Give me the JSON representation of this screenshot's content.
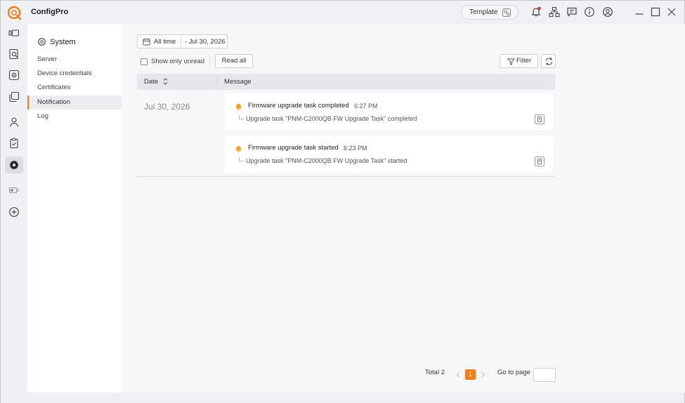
{
  "app": {
    "title": "ConfigPro",
    "brand_color": "#f07d1e"
  },
  "titlebar": {
    "template_label": "Template",
    "icons": [
      "bell-icon",
      "network-icon",
      "chat-icon",
      "info-icon",
      "user-icon"
    ],
    "window_controls": [
      "minimize-icon",
      "maximize-icon",
      "close-icon"
    ]
  },
  "rail": {
    "icons": [
      "devices-icon",
      "search-doc-icon",
      "settings-box-icon",
      "layers-icon",
      "user-icon",
      "clipboard-icon",
      "gear-icon",
      "battery-icon",
      "add-circle-icon"
    ],
    "active": "gear-icon"
  },
  "sidebar": {
    "title": "System",
    "items": [
      {
        "label": "Server",
        "active": false
      },
      {
        "label": "Device credentials",
        "active": false
      },
      {
        "label": "Certificates",
        "active": false
      },
      {
        "label": "Notification",
        "active": true
      },
      {
        "label": "Log",
        "active": false
      }
    ]
  },
  "toolbar": {
    "date_from": "All time",
    "date_to": "- Jul 30, 2026",
    "show_unread_label": "Show only unread",
    "show_unread_checked": false,
    "read_all_label": "Read all",
    "filter_label": "Filter"
  },
  "table": {
    "columns": [
      "Date",
      "Message"
    ],
    "groups": [
      {
        "date": "Jul 30, 2026",
        "messages": [
          {
            "title": "Firmware upgrade task completed",
            "time": "6:27 PM",
            "detail": "Upgrade task \"PNM-C2000QB FW Upgrade Task\" completed"
          },
          {
            "title": "Firmware upgrade task started",
            "time": "6:23 PM",
            "detail": "Upgrade task \"PNM-C2000QB FW Upgrade Task\" started"
          }
        ]
      }
    ]
  },
  "pagination": {
    "total_label": "Total 2",
    "current_page": "1",
    "goto_label": "Go to page",
    "goto_value": ""
  }
}
